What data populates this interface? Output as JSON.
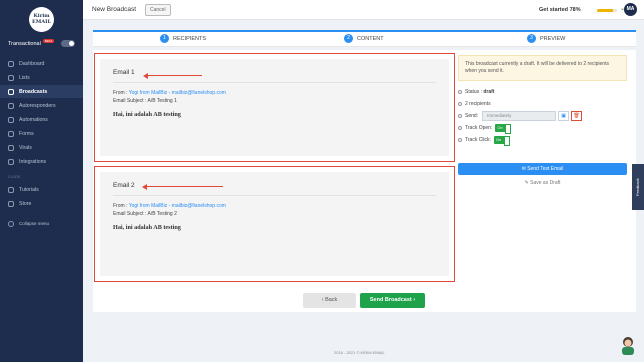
{
  "sidebar": {
    "logo_line1": "Kirim",
    "logo_line2": "EMAIL",
    "mode_label": "Transactional",
    "mode_badge": "BETA",
    "nav": [
      {
        "label": "Dashboard"
      },
      {
        "label": "Lists"
      },
      {
        "label": "Broadcasts"
      },
      {
        "label": "Autoresponders"
      },
      {
        "label": "Automations"
      },
      {
        "label": "Forms"
      },
      {
        "label": "Virals"
      },
      {
        "label": "Integrations"
      }
    ],
    "section_label": "GUIDE",
    "guide": [
      {
        "label": "Tutorials"
      },
      {
        "label": "Store"
      }
    ],
    "collapse_label": "Collapse menu"
  },
  "topbar": {
    "title": "New Broadcast",
    "cancel": "Cancel",
    "get_started": "Get started",
    "progress_text": "78%",
    "progress_value": 78,
    "avatar": "MA"
  },
  "steps": [
    {
      "num": "1",
      "label": "RECIPIENTS"
    },
    {
      "num": "2",
      "label": "CONTENT"
    },
    {
      "num": "3",
      "label": "PREVIEW"
    }
  ],
  "emails": [
    {
      "title": "Email 1",
      "from_label": "From :",
      "from_value": "Yogi from MailBiz - mailbiz@fianelshop.com",
      "subject_label": "Email Subject :",
      "subject_value": "A/B Testing 1",
      "body": "Hai, ini adalah AB testing"
    },
    {
      "title": "Email 2",
      "from_label": "From :",
      "from_value": "Yogi from MailBiz - mailbiz@fianelshop.com",
      "subject_label": "Email Subject :",
      "subject_value": "A/B Testing 2",
      "body": "Hai, ini adalah AB testing"
    }
  ],
  "side": {
    "notice": "This broadcast currently a draft. It will be delivered to 2 recipients when you send it.",
    "status_label": "Status :",
    "status_value": "draft",
    "recipients": "2 recipients",
    "send_label": "Send:",
    "send_value": "Immediately",
    "track_open": "Track Open:",
    "track_click": "Track Click:",
    "switch_on": "On",
    "test_email": "Send Test Email",
    "save_draft": "Save as Draft"
  },
  "actions": {
    "back": "‹  Back",
    "send": "Send Broadcast  ›"
  },
  "footer": "2016 - 2021 © KIRIM.EMAIL",
  "feedback": "Feedback"
}
